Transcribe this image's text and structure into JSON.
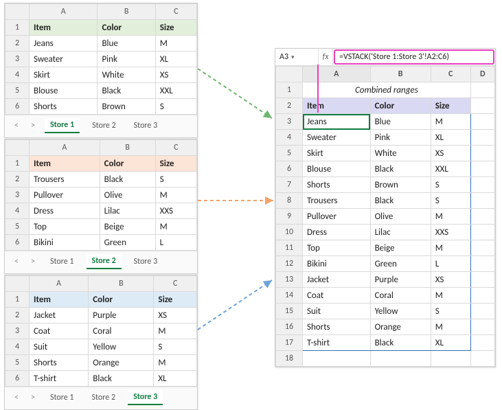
{
  "columns": [
    "A",
    "B",
    "C"
  ],
  "header": {
    "item": "Item",
    "color": "Color",
    "size": "Size"
  },
  "store1": {
    "tab_active": "Store 1",
    "rows": [
      {
        "a": "Jeans",
        "b": "Blue",
        "c": "M"
      },
      {
        "a": "Sweater",
        "b": "Pink",
        "c": "XL"
      },
      {
        "a": "Skirt",
        "b": "White",
        "c": "XS"
      },
      {
        "a": "Blouse",
        "b": "Black",
        "c": "XXL"
      },
      {
        "a": "Shorts",
        "b": "Brown",
        "c": "S"
      }
    ]
  },
  "store2": {
    "tab_active": "Store 2",
    "rows": [
      {
        "a": "Trousers",
        "b": "Black",
        "c": "S"
      },
      {
        "a": "Pullover",
        "b": "Olive",
        "c": "M"
      },
      {
        "a": "Dress",
        "b": "Lilac",
        "c": "XXS"
      },
      {
        "a": "Top",
        "b": "Beige",
        "c": "M"
      },
      {
        "a": "Bikini",
        "b": "Green",
        "c": "L"
      }
    ]
  },
  "store3": {
    "tab_active": "Store 3",
    "rows": [
      {
        "a": "Jacket",
        "b": "Purple",
        "c": "XS"
      },
      {
        "a": "Coat",
        "b": "Coral",
        "c": "M"
      },
      {
        "a": "Suit",
        "b": "Yellow",
        "c": "S"
      },
      {
        "a": "Shorts",
        "b": "Orange",
        "c": "M"
      },
      {
        "a": "T-shirt",
        "b": "Black",
        "c": "XL"
      }
    ]
  },
  "tabs": [
    "Store 1",
    "Store 2",
    "Store 3"
  ],
  "nav_left": "<",
  "nav_right": ">",
  "combined": {
    "cellref": "A3",
    "fx": "fx",
    "formula": "=VSTACK('Store 1:Store 3'!A2:C6)",
    "columns": [
      "A",
      "B",
      "C",
      "D"
    ],
    "title": "Combined ranges",
    "rows": [
      {
        "a": "Jeans",
        "b": "Blue",
        "c": "M"
      },
      {
        "a": "Sweater",
        "b": "Pink",
        "c": "XL"
      },
      {
        "a": "Skirt",
        "b": "White",
        "c": "XS"
      },
      {
        "a": "Blouse",
        "b": "Black",
        "c": "XXL"
      },
      {
        "a": "Shorts",
        "b": "Brown",
        "c": "S"
      },
      {
        "a": "Trousers",
        "b": "Black",
        "c": "S"
      },
      {
        "a": "Pullover",
        "b": "Olive",
        "c": "M"
      },
      {
        "a": "Dress",
        "b": "Lilac",
        "c": "XXS"
      },
      {
        "a": "Top",
        "b": "Beige",
        "c": "M"
      },
      {
        "a": "Bikini",
        "b": "Green",
        "c": "L"
      },
      {
        "a": "Jacket",
        "b": "Purple",
        "c": "XS"
      },
      {
        "a": "Coat",
        "b": "Coral",
        "c": "M"
      },
      {
        "a": "Suit",
        "b": "Yellow",
        "c": "S"
      },
      {
        "a": "Shorts",
        "b": "Orange",
        "c": "M"
      },
      {
        "a": "T-shirt",
        "b": "Black",
        "c": "XL"
      }
    ]
  },
  "colors": {
    "arrow_green": "#6fb76f",
    "arrow_orange": "#f2a26b",
    "arrow_blue": "#6fa3d9",
    "pink": "#e83ebf"
  }
}
